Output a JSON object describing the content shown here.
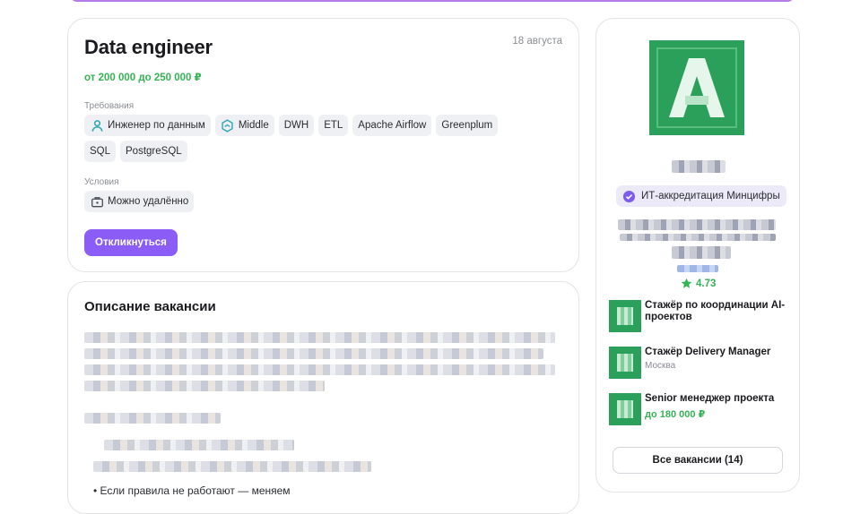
{
  "vacancy": {
    "title": "Data engineer",
    "date": "18 августа",
    "salary": "от 200 000 до 250 000 ₽",
    "requirements_label": "Требования",
    "tags": [
      {
        "label": "Инженер по данным",
        "icon": "person-icon"
      },
      {
        "label": "Middle",
        "icon": "hexagon-level-icon"
      },
      {
        "label": "DWH"
      },
      {
        "label": "ETL"
      },
      {
        "label": "Apache Airflow"
      },
      {
        "label": "Greenplum"
      },
      {
        "label": "SQL"
      },
      {
        "label": "PostgreSQL"
      }
    ],
    "conditions_label": "Условия",
    "condition": {
      "label": "Можно удалённо",
      "icon": "briefcase-icon"
    },
    "apply_label": "Откликнуться"
  },
  "description": {
    "title": "Описание вакансии",
    "bullet_text": "• Если правила не работают — меняем"
  },
  "company": {
    "accreditation": "ИТ-аккредитация Минцифры",
    "rating": "4.73",
    "vacancies": [
      {
        "title": "Стажёр по координации AI-проектов",
        "sub": ""
      },
      {
        "title": "Стажёр Delivery Manager",
        "sub": "Москва"
      },
      {
        "title": "Senior менеджер проекта",
        "salary": "до 180 000 ₽"
      }
    ],
    "all_vacancies_label": "Все вакансии (14)"
  },
  "colors": {
    "accent": "#8b5cf6",
    "salary_green": "#36b255",
    "brand_green": "#2aa05a"
  }
}
